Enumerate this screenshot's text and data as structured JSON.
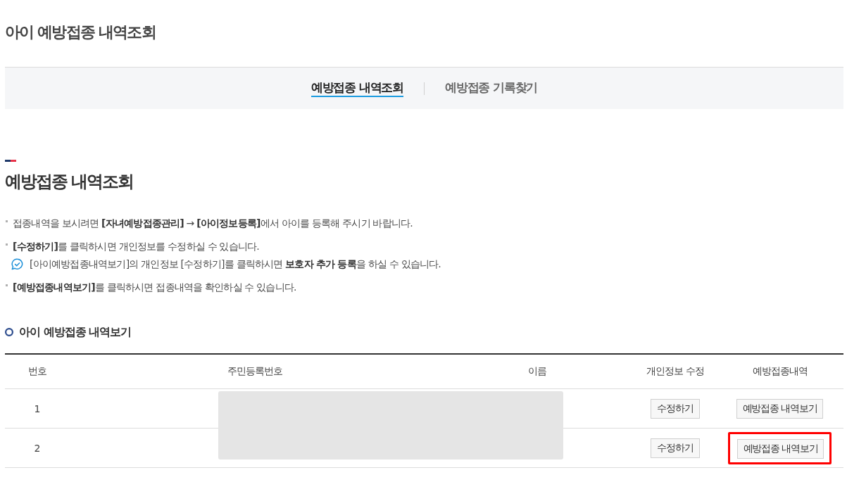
{
  "page_title": "아이 예방접종 내역조회",
  "tabs": [
    {
      "label": "예방접종 내역조회",
      "selected": true
    },
    {
      "label": "예방접종 기록찾기",
      "selected": false
    }
  ],
  "section": {
    "title": "예방접종 내역조회"
  },
  "notes": [
    {
      "text": "접종내역을 보시려면 **[자녀예방접종관리]** → **[아이정보등록]**에서 아이를 등록해 주시기 바랍니다."
    },
    {
      "text": "**[수정하기]**를 클릭하시면 개인정보를 수정하실 수 있습니다.",
      "children": [
        {
          "text": "[아이예방접종내역보기]의 개인정보 [수정하기]를 클릭하시면 **보호자 추가 등록**을 하실 수 있습니다."
        }
      ]
    },
    {
      "text": "**[예방접종내역보기]**를 클릭하시면 접종내역을 확인하실 수 있습니다."
    }
  ],
  "table": {
    "title": "아이 예방접종 내역보기",
    "columns": [
      "번호",
      "주민등록번호",
      "이름",
      "개인정보 수정",
      "예방접종내역"
    ],
    "redacted": true,
    "rows": [
      {
        "number": "1",
        "edit_button": "수정하기",
        "history_button": "예방접종 내역보기",
        "highlighted": false
      },
      {
        "number": "2",
        "edit_button": "수정하기",
        "history_button": "예방접종 내역보기",
        "highlighted": true
      }
    ]
  }
}
